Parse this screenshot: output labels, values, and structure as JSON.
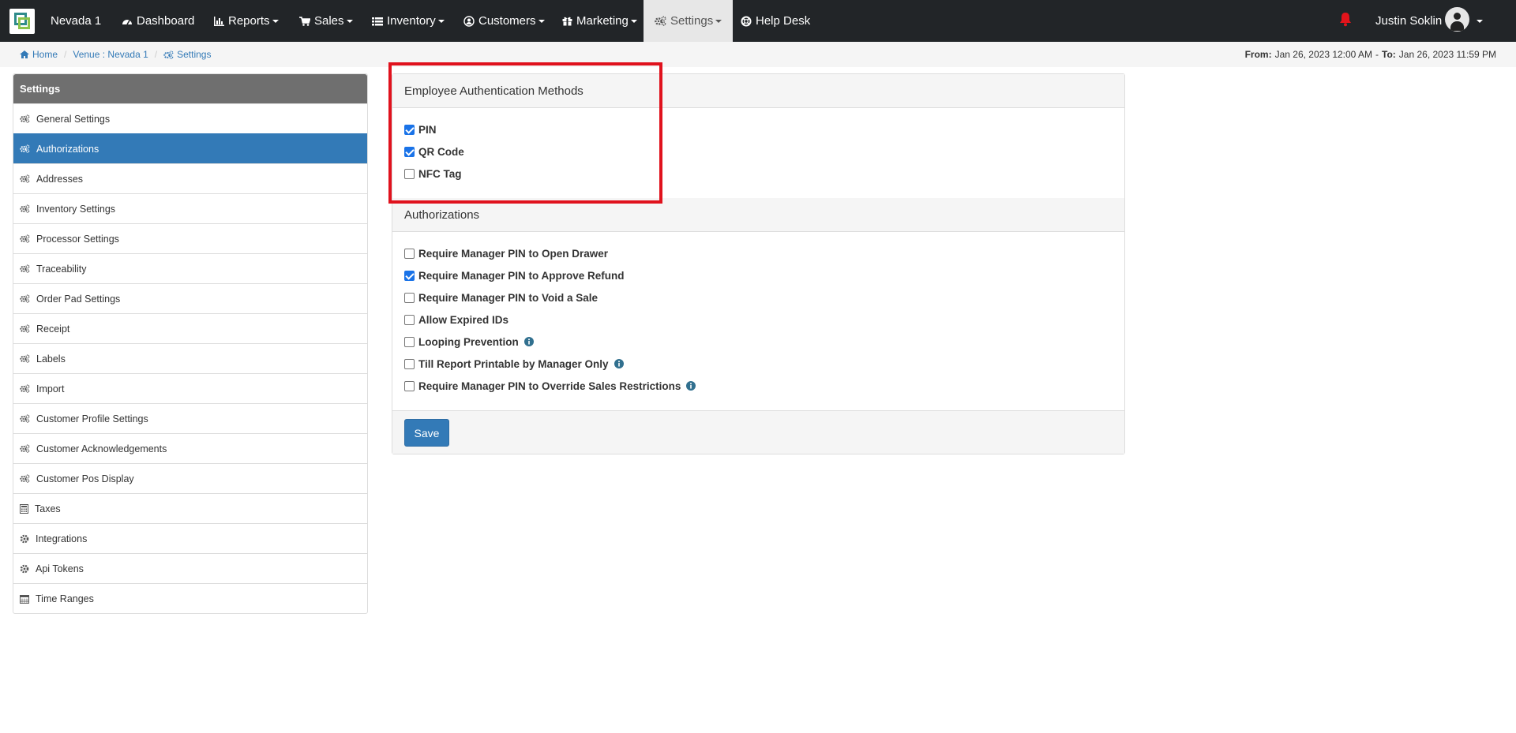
{
  "navbar": {
    "venue_name": "Nevada 1",
    "items": [
      {
        "label": "Dashboard",
        "icon": "dashboard-icon"
      },
      {
        "label": "Reports",
        "icon": "bar-chart-icon"
      },
      {
        "label": "Sales",
        "icon": "cart-icon"
      },
      {
        "label": "Inventory",
        "icon": "list-icon"
      },
      {
        "label": "Customers",
        "icon": "user-circle-icon"
      },
      {
        "label": "Marketing",
        "icon": "gift-icon"
      },
      {
        "label": "Settings",
        "icon": "gears-icon"
      },
      {
        "label": "Help Desk",
        "icon": "lifebuoy-icon"
      }
    ],
    "user_name": "Justin Soklin",
    "bell_color": "#e3141b"
  },
  "breadcrumb": {
    "home": "Home",
    "venue": "Venue : Nevada 1",
    "current": "Settings"
  },
  "date_range": {
    "from_label": "From:",
    "from_value": "Jan 26, 2023 12:00 AM",
    "separator": "-",
    "to_label": "To:",
    "to_value": "Jan 26, 2023 11:59 PM"
  },
  "sidebar": {
    "title": "Settings",
    "items": [
      {
        "label": "General Settings",
        "icon": "gears-icon"
      },
      {
        "label": "Authorizations",
        "icon": "gears-icon"
      },
      {
        "label": "Addresses",
        "icon": "gears-icon"
      },
      {
        "label": "Inventory Settings",
        "icon": "gears-icon"
      },
      {
        "label": "Processor Settings",
        "icon": "gears-icon"
      },
      {
        "label": "Traceability",
        "icon": "gears-icon"
      },
      {
        "label": "Order Pad Settings",
        "icon": "gears-icon"
      },
      {
        "label": "Receipt",
        "icon": "gears-icon"
      },
      {
        "label": "Labels",
        "icon": "gears-icon"
      },
      {
        "label": "Import",
        "icon": "gears-icon"
      },
      {
        "label": "Customer Profile Settings",
        "icon": "gears-icon"
      },
      {
        "label": "Customer Acknowledgements",
        "icon": "gears-icon"
      },
      {
        "label": "Customer Pos Display",
        "icon": "gears-icon"
      },
      {
        "label": "Taxes",
        "icon": "calculator-icon"
      },
      {
        "label": "Integrations",
        "icon": "gear-icon"
      },
      {
        "label": "Api Tokens",
        "icon": "gear-icon"
      },
      {
        "label": "Time Ranges",
        "icon": "calendar-icon"
      }
    ]
  },
  "employee_auth": {
    "title": "Employee Authentication Methods",
    "options": [
      {
        "label": "PIN",
        "checked": true
      },
      {
        "label": "QR Code",
        "checked": true
      },
      {
        "label": "NFC Tag",
        "checked": false
      }
    ]
  },
  "authorizations": {
    "title": "Authorizations",
    "options": [
      {
        "label": "Require Manager PIN to Open Drawer",
        "checked": false
      },
      {
        "label": "Require Manager PIN to Approve Refund",
        "checked": true
      },
      {
        "label": "Require Manager PIN to Void a Sale",
        "checked": false
      },
      {
        "label": "Allow Expired IDs",
        "checked": false
      },
      {
        "label": "Looping Prevention",
        "checked": false
      },
      {
        "label": "Till Report Printable by Manager Only",
        "checked": false
      },
      {
        "label": "Require Manager PIN to Override Sales Restrictions",
        "checked": false
      }
    ]
  },
  "save_label": "Save",
  "colors": {
    "navbar_bg": "#222528",
    "primary": "#337ab7",
    "highlight": "#e0121d"
  }
}
